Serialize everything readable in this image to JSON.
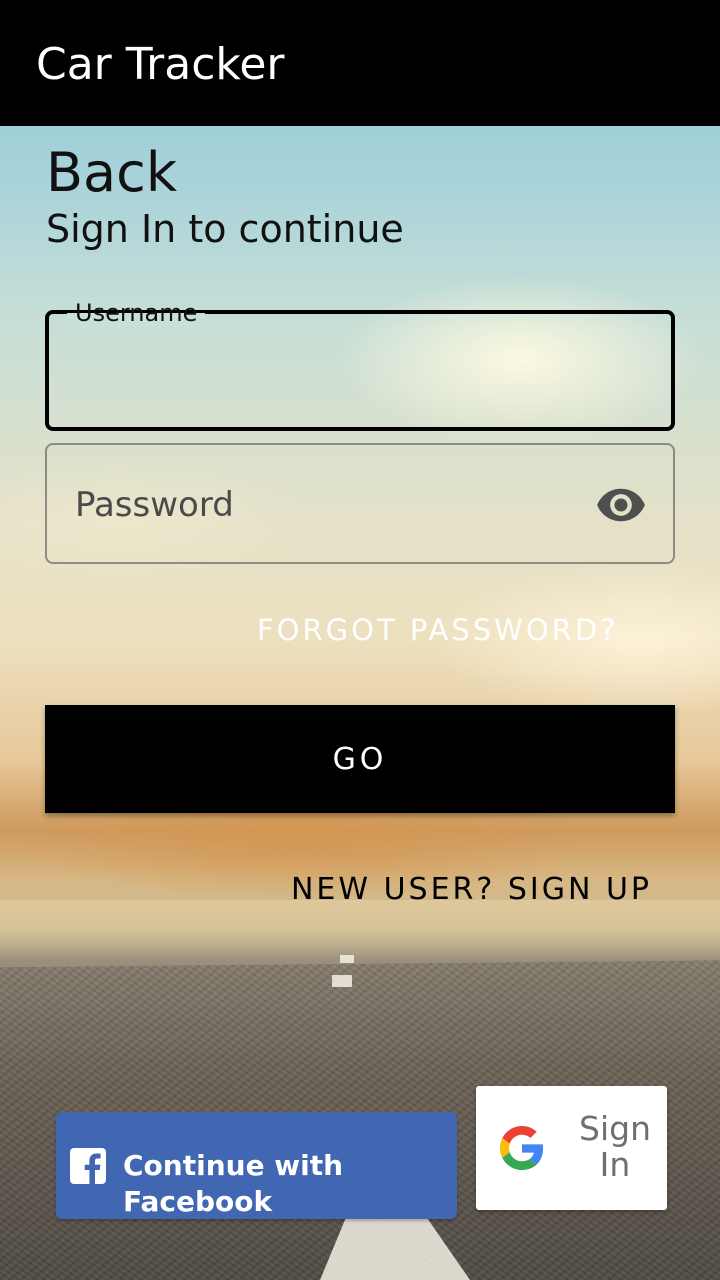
{
  "app_bar": {
    "title": "Car Tracker"
  },
  "welcome": {
    "heading_line2": "Back",
    "subheading": "Sign In to continue"
  },
  "form": {
    "username": {
      "label": "Username",
      "value": ""
    },
    "password": {
      "placeholder": "Password",
      "value": "",
      "toggle_icon": "eye-icon"
    },
    "forgot_label": "FORGOT PASSWORD?",
    "go_label": "GO",
    "signup_label": "NEW USER? SIGN UP"
  },
  "social": {
    "facebook": {
      "label": "Continue with Facebook",
      "icon": "facebook-icon",
      "color": "#4267b2"
    },
    "google": {
      "label": "Sign In",
      "icon": "google-icon"
    }
  },
  "colors": {
    "app_bar": "#000000",
    "primary_button": "#000000",
    "link_light": "#ffffff",
    "link_dark": "#000000"
  }
}
